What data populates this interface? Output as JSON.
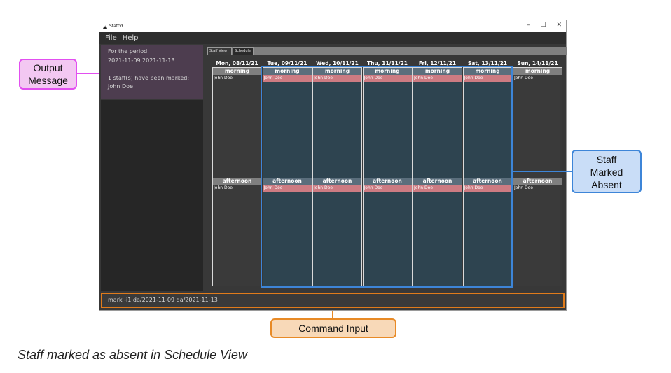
{
  "window": {
    "title": "Staff'd",
    "controls": {
      "minimize": "–",
      "maximize": "☐",
      "close": "✕"
    }
  },
  "menu": [
    "File",
    "Help"
  ],
  "result": {
    "lines": [
      "For the period:",
      "2021-11-09 2021-11-13",
      "",
      "1 staff(s) have been marked:",
      "John Doe"
    ]
  },
  "tabs": [
    "Staff View",
    "Schedule"
  ],
  "schedule": {
    "days": [
      {
        "label": "Mon, 08/11/21",
        "absent": false
      },
      {
        "label": "Tue, 09/11/21",
        "absent": true
      },
      {
        "label": "Wed, 10/11/21",
        "absent": true
      },
      {
        "label": "Thu, 11/11/21",
        "absent": true
      },
      {
        "label": "Fri, 12/11/21",
        "absent": true
      },
      {
        "label": "Sat, 13/11/21",
        "absent": true
      },
      {
        "label": "Sun, 14/11/21",
        "absent": false
      }
    ],
    "morning_label": "morning",
    "afternoon_label": "afternoon",
    "staff_name": "John Doe"
  },
  "command": {
    "value": "mark -i1 da/2021-11-09 da/2021-11-13"
  },
  "annotations": {
    "output_message": "Output Message",
    "staff_marked_absent": "Staff Marked Absent",
    "command_input": "Command Input"
  },
  "caption": "Staff marked as absent in Schedule View",
  "colors": {
    "output_accent": "#e24ff0",
    "absent_accent": "#3d85d8",
    "command_accent": "#e88a26",
    "absent_row": "#cd7b82"
  }
}
